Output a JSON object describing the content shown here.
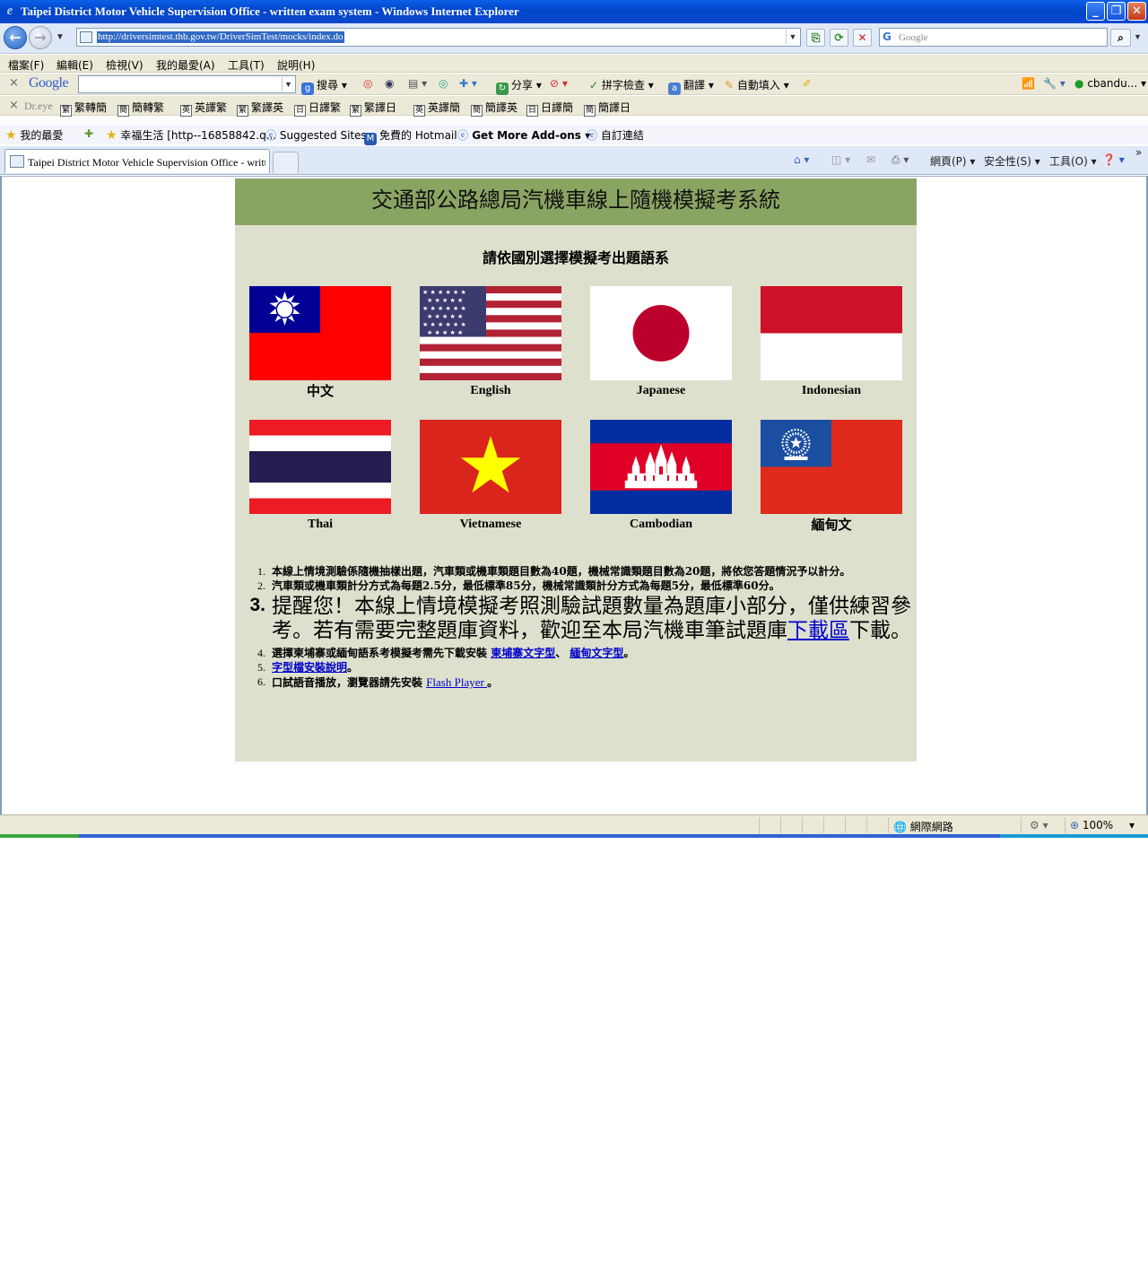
{
  "window": {
    "title": "Taipei District Motor Vehicle Supervision Office - written exam system - Windows Internet Explorer"
  },
  "address_bar": {
    "url": "http://driversimtest.thb.gov.tw/DriverSimTest/mocks/index.do",
    "search_placeholder": "Google"
  },
  "menu": [
    "檔案(F)",
    "編輯(E)",
    "檢視(V)",
    "我的最愛(A)",
    "工具(T)",
    "說明(H)"
  ],
  "google_toolbar": {
    "logo": "Google",
    "search_label": "搜尋",
    "share_label": "分享",
    "spellcheck_label": "拼字檢查",
    "translate_label": "翻譯",
    "autofill_label": "自動填入",
    "account": "cbandu..."
  },
  "dreye_toolbar": {
    "brand": "Dr.eye",
    "items": [
      {
        "box": "繁",
        "label": "繁轉簡"
      },
      {
        "box": "簡",
        "label": "簡轉繁"
      },
      {
        "box": "英",
        "label": "英譯繁"
      },
      {
        "box": "繁",
        "label": "繁譯英"
      },
      {
        "box": "日",
        "label": "日譯繁"
      },
      {
        "box": "繁",
        "label": "繁譯日"
      },
      {
        "box": "英",
        "label": "英譯簡"
      },
      {
        "box": "簡",
        "label": "簡譯英"
      },
      {
        "box": "日",
        "label": "日譯簡"
      },
      {
        "box": "簡",
        "label": "簡譯日"
      }
    ]
  },
  "favorites_bar": {
    "favorites_label": "我的最愛",
    "links": [
      "幸福生活 [http--16858842.q...",
      "Suggested Sites",
      "免費的 Hotmail",
      "Get More Add-ons",
      "自訂連結"
    ]
  },
  "tabs": {
    "active_label": "Taipei District Motor Vehicle Supervision Office - writt..."
  },
  "command_bar": {
    "page": "網頁(P)",
    "safety": "安全性(S)",
    "tools": "工具(O)"
  },
  "page": {
    "heading": "交通部公路總局汽機車線上隨機模擬考系統",
    "subtitle": "請依國別選擇模擬考出題語系",
    "flags": [
      {
        "label": "中文",
        "icon": "taiwan-flag"
      },
      {
        "label": "English",
        "icon": "usa-flag"
      },
      {
        "label": "Japanese",
        "icon": "japan-flag"
      },
      {
        "label": "Indonesian",
        "icon": "indonesia-flag"
      },
      {
        "label": "Thai",
        "icon": "thailand-flag"
      },
      {
        "label": "Vietnamese",
        "icon": "vietnam-flag"
      },
      {
        "label": "Cambodian",
        "icon": "cambodia-flag"
      },
      {
        "label": "緬甸文",
        "icon": "myanmar-flag"
      }
    ],
    "notes": {
      "n1": "本線上情境測驗係隨機抽樣出題，汽車類或機車類題目數為40題，機械常識類題目數為20題，將依您答題情況予以計分。",
      "n2": "汽車類或機車類計分方式為每題2.5分，最低標準85分，機械常識類計分方式為每題5分，最低標準60分。",
      "n3_text": "提醒您！本線上情境模擬考照測驗試題數量為題庫小部分，僅供練習參考。若有需要完整題庫資料，歡迎至本局汽機車筆試題庫",
      "n3_link": "下載區",
      "n3_tail": "下載。",
      "n4_text": "選擇柬埔寨或緬甸語系考模擬考需先下載安裝 ",
      "n4_link1": "柬埔寨文字型",
      "n4_sep": "、",
      "n4_link2": "緬甸文字型",
      "n4_tail": "。",
      "n5_link": "字型檔安裝說明",
      "n5_tail": "。",
      "n6_text": "口試語音播放，瀏覽器請先安裝 ",
      "n6_link": "Flash Player ",
      "n6_tail": "。"
    }
  },
  "status_bar": {
    "zone": "網際網路",
    "zoom": "100%"
  },
  "colors": {
    "header_green": "#8aa462",
    "page_bg": "#dde0cc",
    "link": "#0000cc"
  }
}
